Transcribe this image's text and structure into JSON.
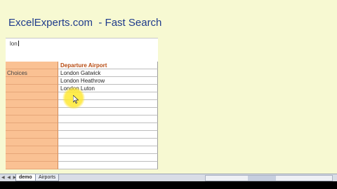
{
  "title": "ExcelExperts.com  - Fast Search",
  "search": {
    "value": "lon"
  },
  "table": {
    "header": "Departure Airport",
    "side_label": "Choices",
    "results": [
      "London Gatwick",
      "London Heathrow",
      "London Luton"
    ]
  },
  "sheet_tabs": [
    "demo",
    "Airports"
  ],
  "sheet_nav": "◀ ◀ ▶ ▶",
  "colors": {
    "background": "#f7f9d2",
    "title": "#1f3b8c",
    "header_text": "#b74a10",
    "side_column": "#fac193",
    "highlight": "#ffee3c"
  },
  "icons": [
    "mouse-pointer-icon"
  ]
}
